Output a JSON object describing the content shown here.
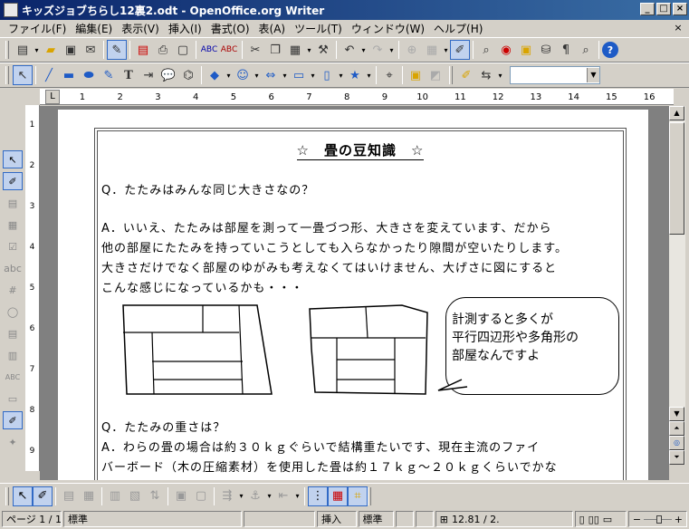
{
  "window": {
    "title": "キッズジョブちらし12裏2.odt - OpenOffice.org Writer",
    "min": "_",
    "max": "□",
    "close": "×"
  },
  "menu": {
    "items": [
      "ファイル(F)",
      "編集(E)",
      "表示(V)",
      "挿入(I)",
      "書式(O)",
      "表(A)",
      "ツール(T)",
      "ウィンドウ(W)",
      "ヘルプ(H)"
    ],
    "close_doc": "×"
  },
  "ruler": {
    "tab_marker": "L",
    "numbers": [
      "1",
      "2",
      "3",
      "4",
      "5",
      "6",
      "7",
      "8",
      "9",
      "10",
      "11",
      "12",
      "13",
      "14",
      "15",
      "16"
    ],
    "vnumbers": [
      "1",
      "2",
      "3",
      "4",
      "5",
      "6",
      "7",
      "8",
      "9"
    ]
  },
  "document": {
    "title": "☆　畳の豆知識　☆",
    "q1": "Q．たたみはみんな同じ大きさなの？",
    "a1_lines": [
      "A．いいえ、たたみは部屋を測って一畳づつ形、大きさを変えています、だから",
      "他の部屋にたたみを持っていこうとしても入らなかったり隙間が空いたりします。",
      "大きさだけでなく部屋のゆがみも考えなくてはいけません、大げさに図にすると",
      "こんな感じになっているかも・・・"
    ],
    "bubble_lines": [
      "計測すると多くが",
      "平行四辺形や多角形の",
      "部屋なんですよ"
    ],
    "q2": "Q．たたみの重さは？",
    "a2_lines": [
      "A．わらの畳の場合は約３０ｋｇぐらいで結構重たいです、現在主流のファイ",
      "バーボード（木の圧縮素材）を使用した畳は約１７ｋｇ～２０ｋｇくらいでかな"
    ]
  },
  "statusbar": {
    "page": "ページ 1 / 1",
    "style": "標準",
    "insert_mode": "挿入",
    "selection_mode": "標準",
    "position": "12.81 / 2."
  },
  "colors": {
    "title_gradient_start": "#0a246a",
    "title_gradient_end": "#3a6ea5",
    "chrome": "#d4d0c8",
    "doc_background": "#808080"
  }
}
